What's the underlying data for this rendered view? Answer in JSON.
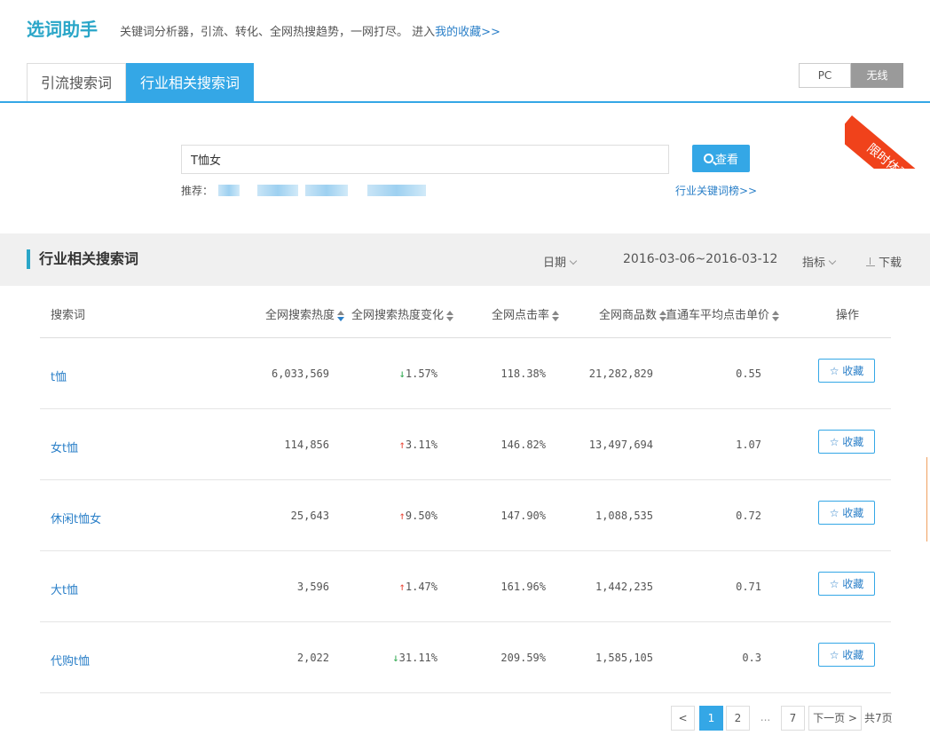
{
  "header": {
    "title": "选词助手",
    "description": "关键词分析器，引流、转化、全网热搜趋势，一网打尽。 进入",
    "favorites_link": "我的收藏>>"
  },
  "tabs": [
    {
      "label": "引流搜索词",
      "active": false
    },
    {
      "label": "行业相关搜索词",
      "active": true
    }
  ],
  "device": {
    "pc_label": "PC",
    "wireless_label": "无线",
    "selected": "无线"
  },
  "ribbon": {
    "label": "限时体验"
  },
  "search": {
    "value": "T恤女",
    "button_label": "查看",
    "recommend_label": "推荐：",
    "industry_link": "行业关键词榜>>"
  },
  "section": {
    "title": "行业相关搜索词",
    "date_label": "日期",
    "date_range": "2016-03-06~2016-03-12",
    "metric_label": "指标",
    "download_label": "下载"
  },
  "table": {
    "columns": [
      "搜索词",
      "全网搜索热度",
      "全网搜索热度变化",
      "全网点击率",
      "全网商品数",
      "直通车平均点击单价",
      "操作"
    ],
    "fav_label": "收藏",
    "rows": [
      {
        "keyword": "t恤",
        "heat": "6,033,569",
        "change": "1.57%",
        "dir": "down",
        "ctr": "118.38%",
        "items": "21,282,829",
        "cpc": "0.55"
      },
      {
        "keyword": "女t恤",
        "heat": "114,856",
        "change": "3.11%",
        "dir": "up",
        "ctr": "146.82%",
        "items": "13,497,694",
        "cpc": "1.07"
      },
      {
        "keyword": "休闲t恤女",
        "heat": "25,643",
        "change": "9.50%",
        "dir": "up",
        "ctr": "147.90%",
        "items": "1,088,535",
        "cpc": "0.72"
      },
      {
        "keyword": "大t恤",
        "heat": "3,596",
        "change": "1.47%",
        "dir": "up",
        "ctr": "161.96%",
        "items": "1,442,235",
        "cpc": "0.71"
      },
      {
        "keyword": "代购t恤",
        "heat": "2,022",
        "change": "31.11%",
        "dir": "down",
        "ctr": "209.59%",
        "items": "1,585,105",
        "cpc": "0.3"
      }
    ]
  },
  "pagination": {
    "prev": "<",
    "pages": [
      "1",
      "2",
      "...",
      "7"
    ],
    "current": "1",
    "next": "下一页 >",
    "total": "共7页"
  }
}
